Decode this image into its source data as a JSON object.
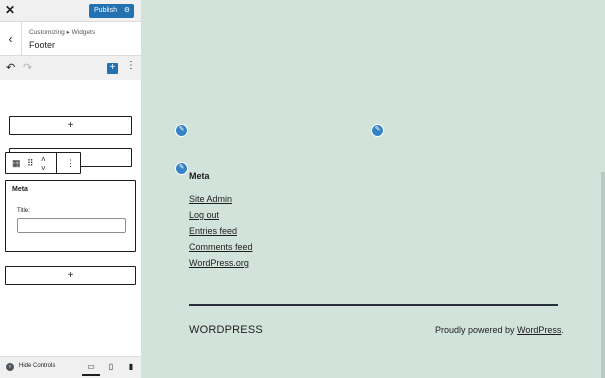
{
  "topbar": {
    "close_icon": "close-icon",
    "publish_label": "Publish",
    "publish_settings_icon": "gear-icon",
    "accent_color": "#2271b1"
  },
  "breadcrumb": {
    "back_icon": "chevron-left-icon",
    "path": "Customizing ▸ Widgets",
    "title": "Footer"
  },
  "toolbar": {
    "undo_icon": "undo-icon",
    "redo_icon": "redo-icon",
    "add_block_icon": "plus-icon",
    "options_icon": "vertical-ellipsis-icon"
  },
  "editor": {
    "inserter_symbol": "+",
    "block_toolbar": {
      "block_icon": "calendar-icon",
      "drag_icon": "drag-handle-icon",
      "move_up_icon": "chevron-up-icon",
      "move_down_icon": "chevron-down-icon",
      "options_icon": "vertical-ellipsis-icon"
    },
    "meta_widget": {
      "title": "Meta",
      "field_label": "Title:",
      "field_value": ""
    }
  },
  "footer_controls": {
    "hide_label": "Hide Controls",
    "devices": [
      "desktop-icon",
      "tablet-icon",
      "mobile-icon"
    ]
  },
  "preview": {
    "edit_shortcut_icon": "pencil-icon",
    "meta_heading": "Meta",
    "meta_links": [
      "Site Admin",
      "Log out",
      "Entries feed",
      "Comments feed",
      "WordPress.org"
    ],
    "site_title": "WORDPRESS",
    "powered_prefix": "Proudly powered by ",
    "powered_link": "WordPress",
    "powered_suffix": ".",
    "background_color": "#d2e3dc"
  }
}
